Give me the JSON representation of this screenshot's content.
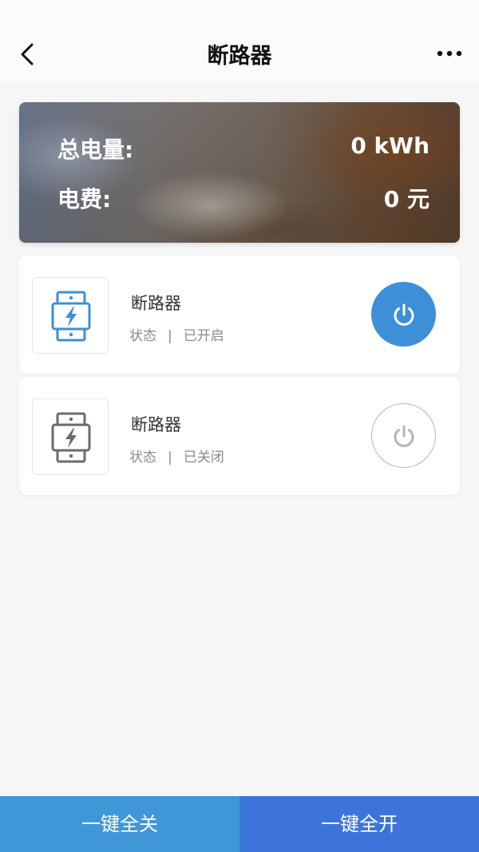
{
  "header": {
    "title": "断路器"
  },
  "summary": {
    "total_label": "总电量:",
    "total_value": "0 kWh",
    "fee_label": "电费:",
    "fee_value": "0 元"
  },
  "devices": [
    {
      "name": "断路器",
      "status_label": "状态",
      "separator": "|",
      "status_value": "已开启",
      "power_on": true,
      "icon": "breaker-icon",
      "icon_color": "#3d8fd8"
    },
    {
      "name": "断路器",
      "status_label": "状态",
      "separator": "|",
      "status_value": "已关闭",
      "power_on": false,
      "icon": "breaker-icon",
      "icon_color": "#6b6b6b"
    }
  ],
  "actions": {
    "all_off_label": "一键全关",
    "all_on_label": "一键全开"
  },
  "colors": {
    "accent": "#3d8fd8",
    "all_off_bg": "#3f97d8",
    "all_on_bg": "#3d74db"
  }
}
